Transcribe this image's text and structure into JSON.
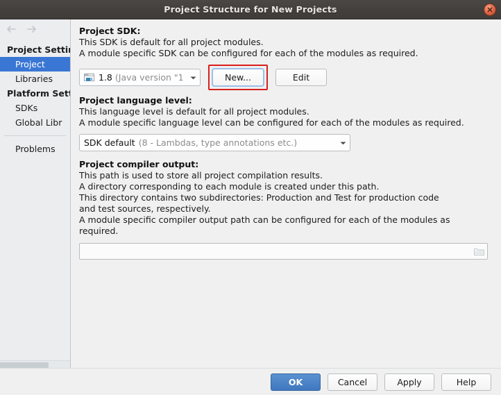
{
  "window": {
    "title": "Project Structure for New Projects",
    "close_icon": "close-icon"
  },
  "nav": {
    "back_icon": "arrow-left-icon",
    "forward_icon": "arrow-right-icon"
  },
  "sidebar": {
    "groups": [
      {
        "label": "Project Settin",
        "items": [
          {
            "label": "Project",
            "selected": true
          },
          {
            "label": "Libraries",
            "selected": false
          }
        ]
      },
      {
        "label": "Platform Sett",
        "items": [
          {
            "label": "SDKs",
            "selected": false
          },
          {
            "label": "Global Libr",
            "selected": false
          }
        ]
      }
    ],
    "problems": {
      "label": "Problems"
    }
  },
  "main": {
    "sdk": {
      "title": "Project SDK:",
      "desc_line1": "This SDK is default for all project modules.",
      "desc_line2": "A module specific SDK can be configured for each of the modules as required.",
      "combo_icon": "java-sdk-icon",
      "combo_value": "1.8",
      "combo_value_dim": "(Java version \"1",
      "dropdown_icon": "chevron-down-icon",
      "new_button": "New...",
      "edit_button": "Edit",
      "highlight_color": "#d81e1e"
    },
    "language_level": {
      "title": "Project language level:",
      "desc_line1": "This language level is default for all project modules.",
      "desc_line2": "A module specific language level can be configured for each of the modules as required.",
      "combo_value": "SDK default",
      "combo_value_dim": "(8 - Lambdas, type annotations etc.)",
      "dropdown_icon": "chevron-down-icon"
    },
    "compiler_output": {
      "title": "Project compiler output:",
      "desc_line1": "This path is used to store all project compilation results.",
      "desc_line2": "A directory corresponding to each module is created under this path.",
      "desc_line3": "This directory contains two subdirectories: Production and Test for production code",
      "desc_line4": "and test sources, respectively.",
      "desc_line5": "A module specific compiler output path can be configured for each of the modules as",
      "desc_line6": "required.",
      "field_value": "",
      "field_placeholder": "",
      "browse_icon": "folder-browse-icon"
    }
  },
  "buttonbar": {
    "ok": "OK",
    "cancel": "Cancel",
    "apply": "Apply",
    "help": "Help",
    "primary_color": "#3f78bf"
  }
}
